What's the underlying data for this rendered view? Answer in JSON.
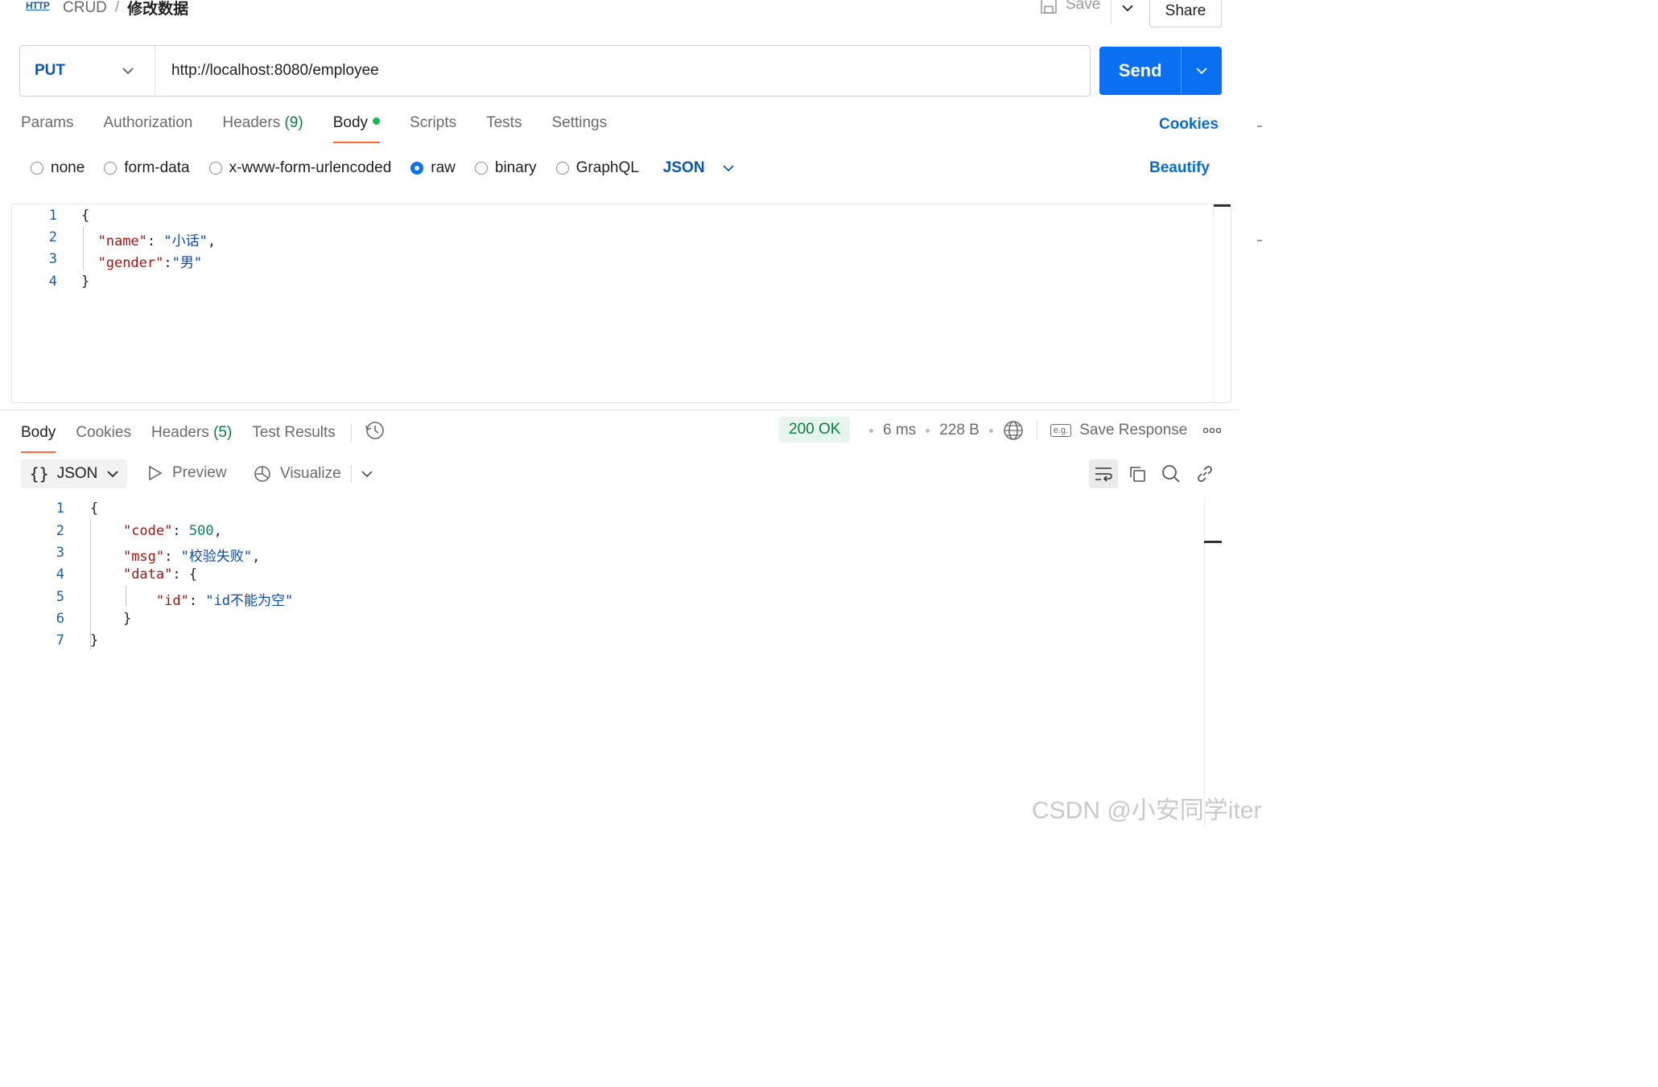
{
  "header": {
    "http_badge": "HTTP",
    "breadcrumb_collection": "CRUD",
    "breadcrumb_separator": "/",
    "breadcrumb_request": "修改数据",
    "save_label": "Save",
    "share_label": "Share"
  },
  "request": {
    "method": "PUT",
    "url": "http://localhost:8080/employee",
    "send_label": "Send"
  },
  "request_tabs": [
    {
      "label": "Params"
    },
    {
      "label": "Authorization"
    },
    {
      "label": "Headers",
      "count": "(9)"
    },
    {
      "label": "Body",
      "active": true,
      "indicator": "green-dot"
    },
    {
      "label": "Scripts"
    },
    {
      "label": "Tests"
    },
    {
      "label": "Settings"
    }
  ],
  "cookies_link": "Cookies",
  "body_options": {
    "modes": [
      "none",
      "form-data",
      "x-www-form-urlencoded",
      "raw",
      "binary",
      "GraphQL"
    ],
    "selected": "raw",
    "raw_type": "JSON",
    "beautify_label": "Beautify"
  },
  "request_body": {
    "line_numbers": [
      "1",
      "2",
      "3",
      "4"
    ],
    "lines": [
      [
        {
          "t": "p",
          "v": "{"
        }
      ],
      [
        {
          "t": "p",
          "v": "  "
        },
        {
          "t": "k",
          "v": "\"name\""
        },
        {
          "t": "p",
          "v": ": "
        },
        {
          "t": "s",
          "v": "\"小话\""
        },
        {
          "t": "p",
          "v": ","
        }
      ],
      [
        {
          "t": "p",
          "v": "  "
        },
        {
          "t": "k",
          "v": "\"gender\""
        },
        {
          "t": "p",
          "v": ":"
        },
        {
          "t": "s",
          "v": "\"男\""
        }
      ],
      [
        {
          "t": "p",
          "v": "}"
        }
      ]
    ]
  },
  "response_tabs": [
    {
      "label": "Body",
      "active": true
    },
    {
      "label": "Cookies"
    },
    {
      "label": "Headers",
      "count": "(5)"
    },
    {
      "label": "Test Results"
    }
  ],
  "response_meta": {
    "status": "200 OK",
    "time": "6 ms",
    "size": "228 B",
    "save_response_label": "Save Response",
    "eg_badge": "e.g."
  },
  "response_toolbar": {
    "format_label": "JSON",
    "format_icon": "{}",
    "preview_label": "Preview",
    "visualize_label": "Visualize"
  },
  "response_body": {
    "line_numbers": [
      "1",
      "2",
      "3",
      "4",
      "5",
      "6",
      "7"
    ],
    "lines": [
      [
        {
          "t": "p",
          "v": "{"
        }
      ],
      [
        {
          "t": "p",
          "v": "    "
        },
        {
          "t": "k",
          "v": "\"code\""
        },
        {
          "t": "p",
          "v": ": "
        },
        {
          "t": "n",
          "v": "500"
        },
        {
          "t": "p",
          "v": ","
        }
      ],
      [
        {
          "t": "p",
          "v": "    "
        },
        {
          "t": "k",
          "v": "\"msg\""
        },
        {
          "t": "p",
          "v": ": "
        },
        {
          "t": "s",
          "v": "\"校验失败\""
        },
        {
          "t": "p",
          "v": ","
        }
      ],
      [
        {
          "t": "p",
          "v": "    "
        },
        {
          "t": "k",
          "v": "\"data\""
        },
        {
          "t": "p",
          "v": ": {"
        }
      ],
      [
        {
          "t": "p",
          "v": "        "
        },
        {
          "t": "k",
          "v": "\"id\""
        },
        {
          "t": "p",
          "v": ": "
        },
        {
          "t": "s",
          "v": "\"id不能为空\""
        }
      ],
      [
        {
          "t": "p",
          "v": "    }"
        }
      ],
      [
        {
          "t": "p",
          "v": "}"
        }
      ]
    ]
  },
  "watermark": "CSDN @小安同学iter"
}
